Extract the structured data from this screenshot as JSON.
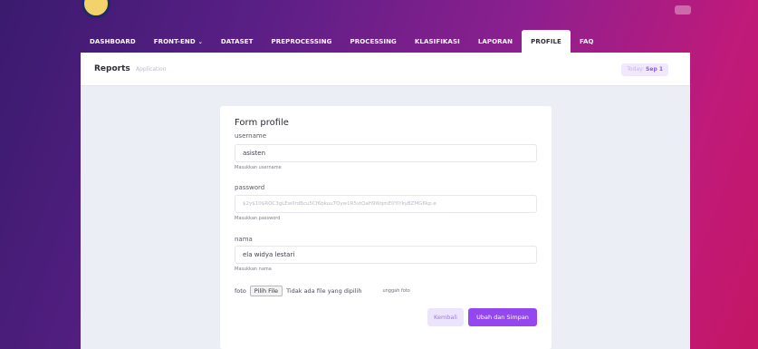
{
  "nav": {
    "items": [
      {
        "label": "DASHBOARD"
      },
      {
        "label": "FRONT-END"
      },
      {
        "label": "DATASET"
      },
      {
        "label": "PREPROCESSING"
      },
      {
        "label": "PROCESSING"
      },
      {
        "label": "KLASIFIKASI"
      },
      {
        "label": "LAPORAN"
      },
      {
        "label": "PROFILE"
      },
      {
        "label": "FAQ"
      }
    ],
    "active": "PROFILE"
  },
  "header": {
    "title": "Reports",
    "subtitle": "Application",
    "today_label": "Today:",
    "today_value": "Sep 1"
  },
  "form": {
    "title": "Form profile",
    "username": {
      "label": "username",
      "value": "asisten",
      "help": "Masukkan username"
    },
    "password": {
      "label": "password",
      "value": "$2y$10$ROC3gLEwIIrdBcu5Cf6bkuuTOyw1R5stQaH9WqmE0YiYkyBZMG6kp.e",
      "help": "Masukkan password"
    },
    "nama": {
      "label": "nama",
      "value": "ela widya lestari",
      "help": "Masukkan nama"
    },
    "foto": {
      "label": "foto",
      "button": "Pilih File",
      "status": "Tidak ada file yang dipilih",
      "hint": "unggah foto"
    },
    "back_button": "Kembali",
    "save_button": "Ubah dan Simpan"
  },
  "colors": {
    "accent": "#9447ef",
    "active_tab_bg": "#ffffff",
    "card_bg": "#eceef5"
  }
}
